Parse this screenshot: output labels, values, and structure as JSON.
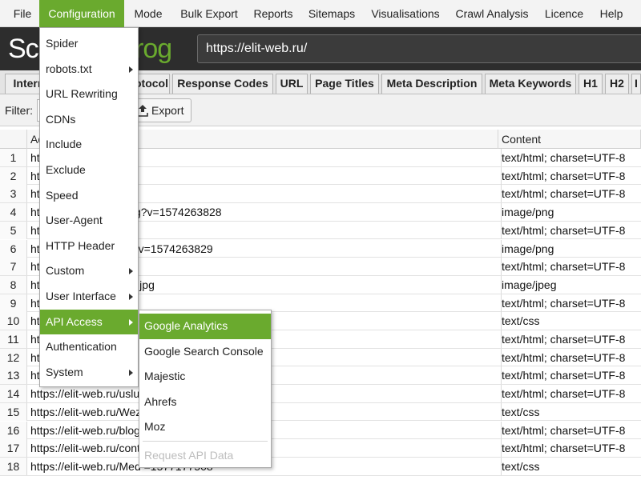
{
  "menubar": {
    "items": [
      "File",
      "Configuration",
      "Mode",
      "Bulk Export",
      "Reports",
      "Sitemaps",
      "Visualisations",
      "Crawl Analysis",
      "Licence",
      "Help"
    ]
  },
  "header": {
    "logo_left": "Scr",
    "logo_right": "rog",
    "url": "https://elit-web.ru/"
  },
  "tabs": [
    "Intern",
    "otocol",
    "Response Codes",
    "URL",
    "Page Titles",
    "Meta Description",
    "Meta Keywords",
    "H1",
    "H2",
    "I"
  ],
  "filter": {
    "label": "Filter:",
    "export_label": "Export"
  },
  "table": {
    "columns": [
      "Ad",
      "Content"
    ],
    "rows": [
      {
        "n": "1",
        "addr": "ht",
        "ct": "text/html; charset=UTF-8"
      },
      {
        "n": "2",
        "addr": "ht                              omance",
        "ct": "text/html; charset=UTF-8"
      },
      {
        "n": "3",
        "addr": "ht                              ut",
        "ct": "text/html; charset=UTF-8"
      },
      {
        "n": "4",
        "addr": "ht                              lia/pic/arrow-up.png?v=1574263828",
        "ct": "image/png"
      },
      {
        "n": "5",
        "addr": "ht                              abotka-saytov",
        "ct": "text/html; charset=UTF-8"
      },
      {
        "n": "6",
        "addr": "ht                              lia/pic/wezom.png?v=1574263829",
        "ct": "image/png"
      },
      {
        "n": "7",
        "addr": "ht                              evements",
        "ct": "text/html; charset=UTF-8"
      },
      {
        "n": "8",
        "addr": "ht                              lia/pic/seo/first-q80.jpg",
        "ct": "image/jpeg"
      },
      {
        "n": "9",
        "addr": "ht                              crisis",
        "ct": "text/html; charset=UTF-8"
      },
      {
        "n": "10",
        "addr": "ht                                                           =1586935676",
        "ct": "text/css"
      },
      {
        "n": "11",
        "addr": "ht",
        "ct": "text/html; charset=UTF-8"
      },
      {
        "n": "12",
        "addr": "ht                                                           niy",
        "ct": "text/html; charset=UTF-8"
      },
      {
        "n": "13",
        "addr": "ht                                                           ytov",
        "ct": "text/html; charset=UTF-8"
      },
      {
        "n": "14",
        "addr": "https://elit-web.ru/uslu",
        "ct": "text/html; charset=UTF-8"
      },
      {
        "n": "15",
        "addr": "https://elit-web.ru/Wez                                          me.css",
        "ct": "text/css"
      },
      {
        "n": "16",
        "addr": "https://elit-web.ru/blog",
        "ct": "text/html; charset=UTF-8"
      },
      {
        "n": "17",
        "addr": "https://elit-web.ru/cont",
        "ct": "text/html; charset=UTF-8"
      },
      {
        "n": "18",
        "addr": "https://elit-web.ru/Med                                       =1577177508",
        "ct": "text/css"
      }
    ]
  },
  "configuration_menu": {
    "items": [
      {
        "label": "Spider",
        "arrow": false
      },
      {
        "label": "robots.txt",
        "arrow": true
      },
      {
        "label": "URL Rewriting",
        "arrow": false
      },
      {
        "label": "CDNs",
        "arrow": false
      },
      {
        "label": "Include",
        "arrow": false
      },
      {
        "label": "Exclude",
        "arrow": false
      },
      {
        "label": "Speed",
        "arrow": false
      },
      {
        "label": "User-Agent",
        "arrow": false
      },
      {
        "label": "HTTP Header",
        "arrow": false
      },
      {
        "label": "Custom",
        "arrow": true
      },
      {
        "label": "User Interface",
        "arrow": true
      },
      {
        "label": "API Access",
        "arrow": true
      },
      {
        "label": "Authentication",
        "arrow": false
      },
      {
        "label": "System",
        "arrow": true
      }
    ]
  },
  "api_submenu": {
    "items": [
      "Google Analytics",
      "Google Search Console",
      "Majestic",
      "Ahrefs",
      "Moz"
    ],
    "disabled_item": "Request API Data"
  },
  "colors": {
    "accent": "#6aaa2e",
    "header_bg": "#2d2d2d"
  }
}
